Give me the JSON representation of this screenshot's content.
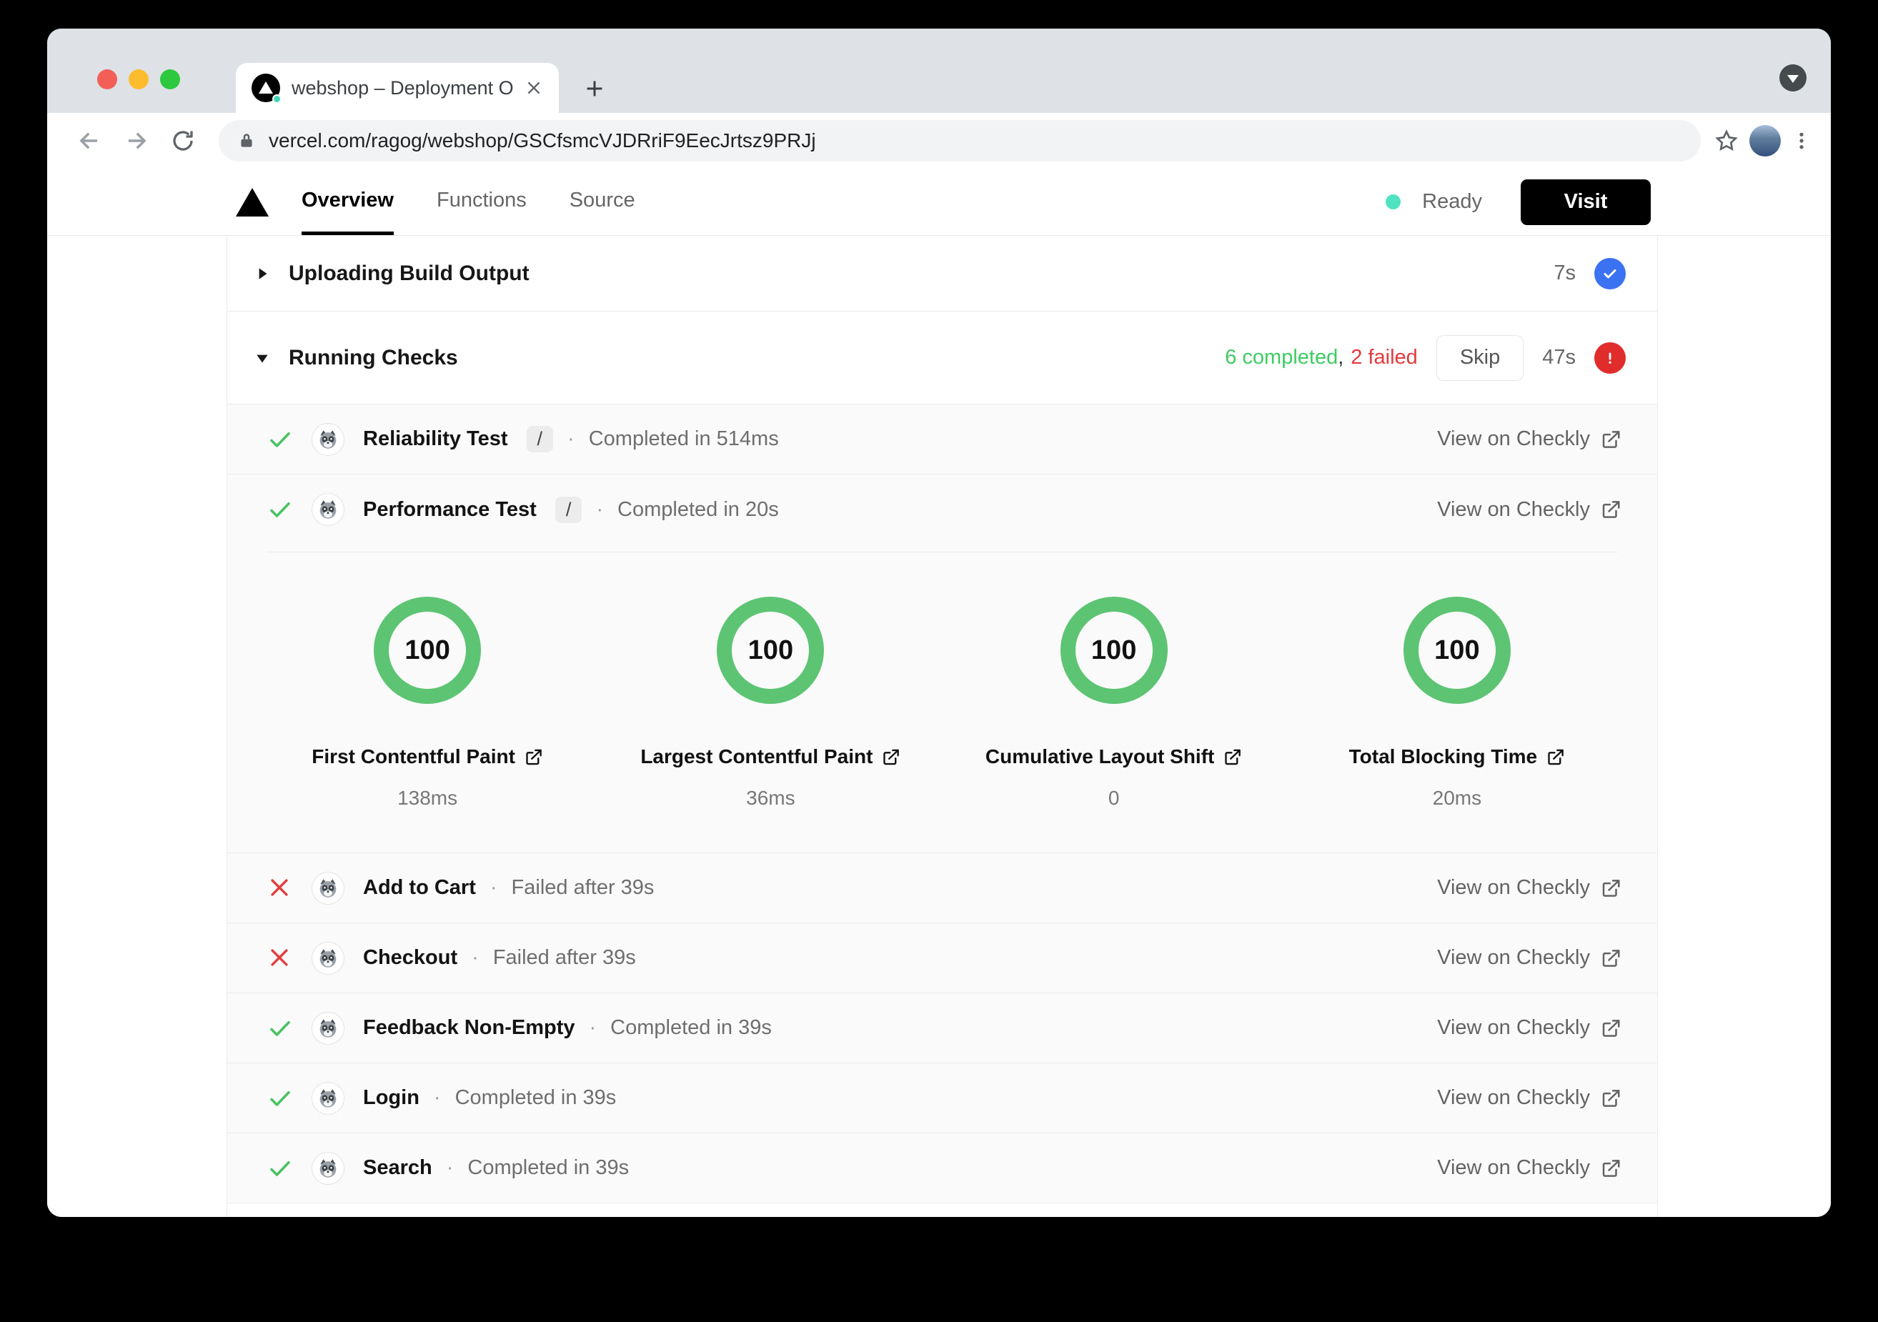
{
  "browser": {
    "tab_title": "webshop – Deployment Overvi",
    "url": "vercel.com/ragog/webshop/GSCfsmcVJDRriF9EecJrtsz9PRJj"
  },
  "nav": {
    "tabs": [
      {
        "label": "Overview"
      },
      {
        "label": "Functions"
      },
      {
        "label": "Source"
      }
    ],
    "status_label": "Ready",
    "visit_label": "Visit"
  },
  "steps": {
    "uploading": {
      "label": "Uploading Build Output",
      "duration": "7s"
    },
    "running": {
      "label": "Running Checks",
      "completed_summary": "6 completed",
      "separator": ",",
      "failed_summary": "2 failed",
      "skip_label": "Skip",
      "duration": "47s"
    }
  },
  "checks": {
    "dot": "·",
    "link_label": "View on Checkly",
    "rows": [
      {
        "name": "Reliability Test",
        "path": "/",
        "status": "Completed in 514ms",
        "state": "success"
      },
      {
        "name": "Performance Test",
        "path": "/",
        "status": "Completed in 20s",
        "state": "success"
      },
      {
        "name": "Add to Cart",
        "status": "Failed after 39s",
        "state": "fail"
      },
      {
        "name": "Checkout",
        "status": "Failed after 39s",
        "state": "fail"
      },
      {
        "name": "Feedback Non-Empty",
        "status": "Completed in 39s",
        "state": "success"
      },
      {
        "name": "Login",
        "status": "Completed in 39s",
        "state": "success"
      },
      {
        "name": "Search",
        "status": "Completed in 39s",
        "state": "success"
      }
    ]
  },
  "metrics": {
    "items": [
      {
        "score": "100",
        "label": "First Contentful Paint",
        "value": "138ms"
      },
      {
        "score": "100",
        "label": "Largest Contentful Paint",
        "value": "36ms"
      },
      {
        "score": "100",
        "label": "Cumulative Layout Shift",
        "value": "0"
      },
      {
        "score": "100",
        "label": "Total Blocking Time",
        "value": "20ms"
      }
    ]
  },
  "colors": {
    "success_green": "#3ecb63",
    "ring_green": "#5dc473",
    "fail_red": "#e5393e",
    "info_blue": "#3b72f2",
    "ready_teal": "#50e3c2"
  }
}
